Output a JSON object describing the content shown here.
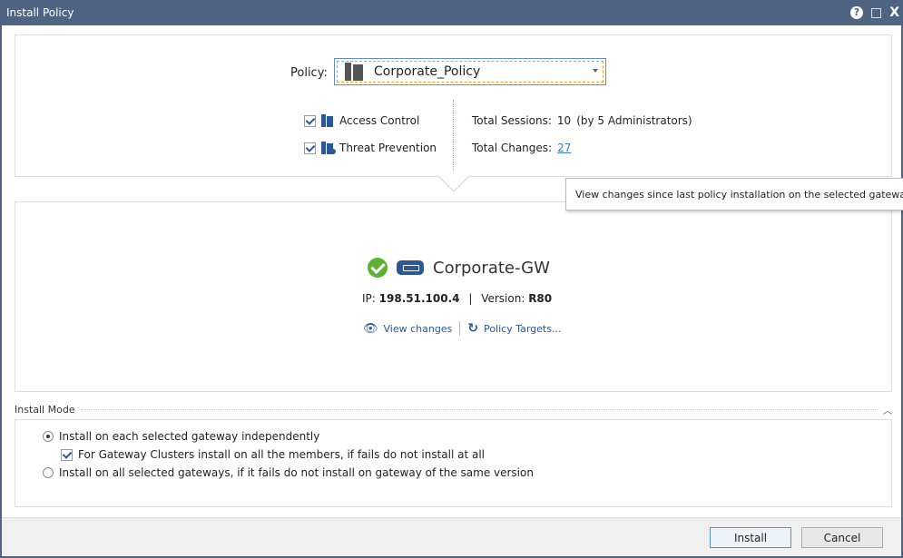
{
  "window": {
    "title": "Install Policy",
    "help": "?",
    "maximize": "□",
    "close": "X"
  },
  "policy": {
    "label": "Policy:",
    "selected": "Corporate_Policy",
    "blades": [
      {
        "label": "Access Control",
        "checked": true
      },
      {
        "label": "Threat Prevention",
        "checked": true
      }
    ],
    "sessions_label": "Total Sessions:",
    "sessions_value": "10",
    "sessions_note": "(by 5 Administrators)",
    "changes_label": "Total Changes:",
    "changes_value": "27",
    "tooltip": "View changes since last policy installation on the selected gateways"
  },
  "gateway": {
    "name": "Corporate-GW",
    "status": "success",
    "ip_label": "IP:",
    "ip": "198.51.100.4",
    "version_label": "Version:",
    "version": "R80",
    "view_changes": "View changes",
    "policy_targets": "Policy Targets..."
  },
  "install_mode": {
    "header": "Install Mode",
    "option1": "Install on each selected gateway independently",
    "sub_option": "For Gateway Clusters install on all the members, if fails do not install at all",
    "option2": "Install on all selected gateways, if it fails do not install on gateway of the same version",
    "selected": 1
  },
  "footer": {
    "install": "Install",
    "cancel": "Cancel"
  },
  "colors": {
    "titlebar": "#4f6483",
    "accent": "#2b5797",
    "link": "#3b7dd8",
    "success": "#5db234"
  }
}
